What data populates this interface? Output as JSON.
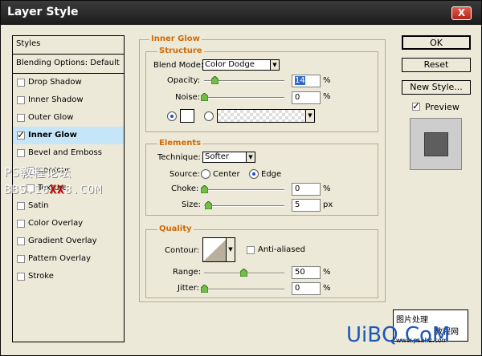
{
  "window": {
    "title": "Layer Style",
    "close_label": "X"
  },
  "styles_list": {
    "header": "Styles",
    "blending": "Blending Options: Default",
    "items": [
      {
        "label": "Drop Shadow",
        "checked": false
      },
      {
        "label": "Inner Shadow",
        "checked": false
      },
      {
        "label": "Outer Glow",
        "checked": false
      },
      {
        "label": "Inner Glow",
        "checked": true
      },
      {
        "label": "Bevel and Emboss",
        "checked": false
      },
      {
        "label": "Contour",
        "checked": false
      },
      {
        "label": "Texture",
        "checked": false
      },
      {
        "label": "Satin",
        "checked": false
      },
      {
        "label": "Color Overlay",
        "checked": false
      },
      {
        "label": "Gradient Overlay",
        "checked": false
      },
      {
        "label": "Pattern Overlay",
        "checked": false
      },
      {
        "label": "Stroke",
        "checked": false
      }
    ]
  },
  "inner_glow": {
    "title": "Inner Glow",
    "structure": {
      "title": "Structure",
      "blend_mode_label": "Blend Mode:",
      "blend_mode_value": "Color Dodge",
      "opacity_label": "Opacity:",
      "opacity_value": "14",
      "noise_label": "Noise:",
      "noise_value": "0",
      "unit_percent": "%"
    },
    "elements": {
      "title": "Elements",
      "technique_label": "Technique:",
      "technique_value": "Softer",
      "source_label": "Source:",
      "source_center": "Center",
      "source_edge": "Edge",
      "choke_label": "Choke:",
      "choke_value": "0",
      "size_label": "Size:",
      "size_value": "5",
      "unit_percent": "%",
      "unit_px": "px"
    },
    "quality": {
      "title": "Quality",
      "contour_label": "Contour:",
      "anti_aliased_label": "Anti-aliased",
      "range_label": "Range:",
      "range_value": "50",
      "jitter_label": "Jitter:",
      "jitter_value": "0",
      "unit_percent": "%"
    }
  },
  "buttons": {
    "ok": "OK",
    "reset": "Reset",
    "new_style": "New Style...",
    "preview_label": "Preview"
  },
  "watermarks": {
    "line1": "PS教程论坛",
    "line2": "BBS.16",
    "line2_tail": "XX",
    "line2_end": "8.COM",
    "stamp_top": "图片处理",
    "stamp_mid": "教程网",
    "stamp_bottom": "www.psahz.com",
    "uibq": "UiBQ.CoM"
  },
  "colors": {
    "group_title": "#d06a07",
    "selected_row": "#c5e6f8",
    "titlebar": "#2a2a2a"
  }
}
